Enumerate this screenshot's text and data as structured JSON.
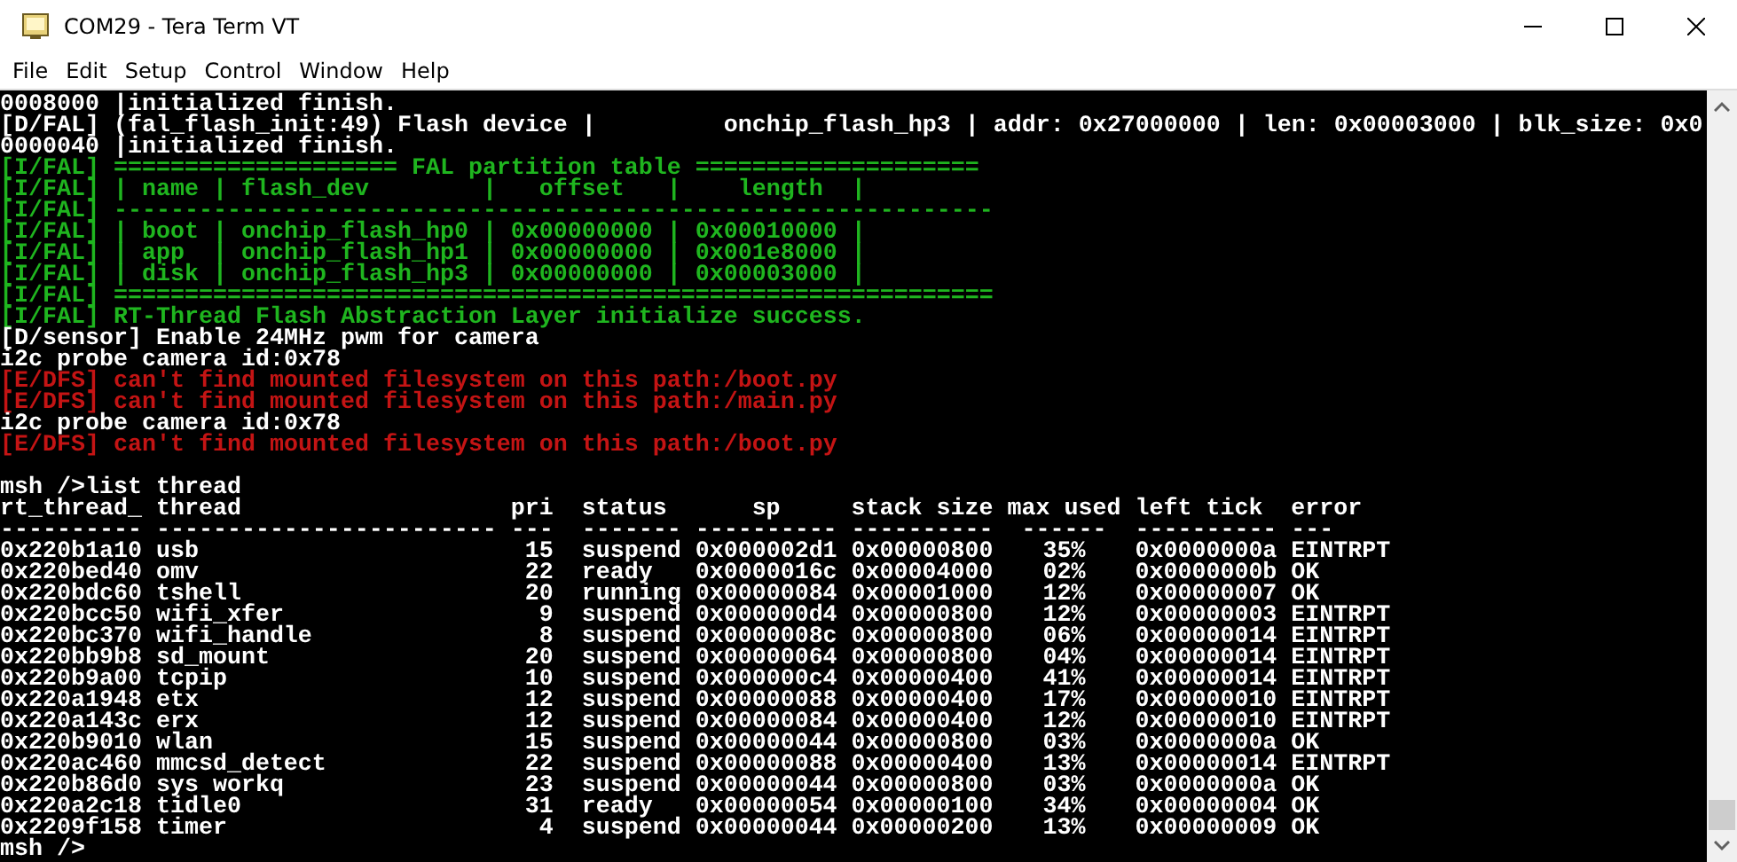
{
  "window": {
    "title": "COM29 - Tera Term VT"
  },
  "menu": [
    "File",
    "Edit",
    "Setup",
    "Control",
    "Window",
    "Help"
  ],
  "terminal": {
    "lines": [
      {
        "kind": "text",
        "color": "#ffffff",
        "text": "0008000 |initialized finish."
      },
      {
        "kind": "text",
        "color": "#ffffff",
        "text": "[D/FAL] (fal_flash_init:49) Flash device |         onchip_flash_hp3 | addr: 0x27000000 | len: 0x00003000 | blk_size: 0x0"
      },
      {
        "kind": "text",
        "color": "#ffffff",
        "text": "0000040 |initialized finish."
      },
      {
        "kind": "text",
        "color": "#1fb51f",
        "text": "[I/FAL] ==================== FAL partition table ===================="
      },
      {
        "kind": "text",
        "color": "#1fb51f",
        "text": "[I/FAL] | name | flash_dev        |   offset   |    length  |"
      },
      {
        "kind": "text",
        "color": "#1fb51f",
        "text": "[I/FAL] --------------------------------------------------------------"
      },
      {
        "kind": "text",
        "color": "#1fb51f",
        "text": "[I/FAL] | boot | onchip_flash_hp0 | 0x00000000 | 0x00010000 |"
      },
      {
        "kind": "text",
        "color": "#1fb51f",
        "text": "[I/FAL] | app  | onchip_flash_hp1 | 0x00000000 | 0x001e8000 |"
      },
      {
        "kind": "text",
        "color": "#1fb51f",
        "text": "[I/FAL] | disk | onchip_flash_hp3 | 0x00000000 | 0x00003000 |"
      },
      {
        "kind": "text",
        "color": "#1fb51f",
        "text": "[I/FAL] =============================================================="
      },
      {
        "kind": "text",
        "color": "#1fb51f",
        "text": "[I/FAL] RT-Thread Flash Abstraction Layer initialize success."
      },
      {
        "kind": "text",
        "color": "#ffffff",
        "text": "[D/sensor] Enable 24MHz pwm for camera"
      },
      {
        "kind": "text",
        "color": "#ffffff",
        "text": "i2c probe camera id:0x78"
      },
      {
        "kind": "text",
        "color": "#c41414",
        "text": "[E/DFS] can't find mounted filesystem on this path:/boot.py"
      },
      {
        "kind": "text",
        "color": "#c41414",
        "text": "[E/DFS] can't find mounted filesystem on this path:/main.py"
      },
      {
        "kind": "text",
        "color": "#ffffff",
        "text": "i2c probe camera id:0x78"
      },
      {
        "kind": "text",
        "color": "#c41414",
        "text": "[E/DFS] can't find mounted filesystem on this path:/boot.py"
      },
      {
        "kind": "blank"
      },
      {
        "kind": "text",
        "color": "#ffffff",
        "text": "msh />list thread"
      }
    ],
    "thread_table": {
      "columns": [
        {
          "label": "rt_thread_",
          "rule": "----------"
        },
        {
          "label": "thread",
          "rule": "------------------------"
        },
        {
          "label": "pri",
          "rule": "---"
        },
        {
          "label": "status",
          "rule": "-------"
        },
        {
          "label": "sp",
          "rule": "----------"
        },
        {
          "label": "stack size",
          "rule": "----------"
        },
        {
          "label": "max used",
          "rule": "------"
        },
        {
          "label": "left tick",
          "rule": "----------"
        },
        {
          "label": "error",
          "rule": "---"
        }
      ],
      "rows": [
        {
          "cells": [
            "0x220b1a10",
            "usb",
            "15",
            "suspend",
            "0x000002d1",
            "0x00000800",
            "35%",
            "0x0000000a",
            "EINTRPT"
          ]
        },
        {
          "cells": [
            "0x220bed40",
            "omv",
            "22",
            "ready",
            "0x0000016c",
            "0x00004000",
            "02%",
            "0x0000000b",
            "OK"
          ]
        },
        {
          "cells": [
            "0x220bdc60",
            "tshell",
            "20",
            "running",
            "0x00000084",
            "0x00001000",
            "12%",
            "0x00000007",
            "OK"
          ]
        },
        {
          "cells": [
            "0x220bcc50",
            "wifi_xfer",
            "9",
            "suspend",
            "0x000000d4",
            "0x00000800",
            "12%",
            "0x00000003",
            "EINTRPT"
          ]
        },
        {
          "cells": [
            "0x220bc370",
            "wifi_handle",
            "8",
            "suspend",
            "0x0000008c",
            "0x00000800",
            "06%",
            "0x00000014",
            "EINTRPT"
          ]
        },
        {
          "cells": [
            "0x220bb9b8",
            "sd_mount",
            "20",
            "suspend",
            "0x00000064",
            "0x00000800",
            "04%",
            "0x00000014",
            "EINTRPT"
          ]
        },
        {
          "cells": [
            "0x220b9a00",
            "tcpip",
            "10",
            "suspend",
            "0x000000c4",
            "0x00000400",
            "41%",
            "0x00000014",
            "EINTRPT"
          ]
        },
        {
          "cells": [
            "0x220a1948",
            "etx",
            "12",
            "suspend",
            "0x00000088",
            "0x00000400",
            "17%",
            "0x00000010",
            "EINTRPT"
          ]
        },
        {
          "cells": [
            "0x220a143c",
            "erx",
            "12",
            "suspend",
            "0x00000084",
            "0x00000400",
            "12%",
            "0x00000010",
            "EINTRPT"
          ]
        },
        {
          "cells": [
            "0x220b9010",
            "wlan",
            "15",
            "suspend",
            "0x00000044",
            "0x00000800",
            "03%",
            "0x0000000a",
            "OK"
          ]
        },
        {
          "cells": [
            "0x220ac460",
            "mmcsd_detect",
            "22",
            "suspend",
            "0x00000088",
            "0x00000400",
            "13%",
            "0x00000014",
            "EINTRPT"
          ]
        },
        {
          "cells": [
            "0x220b86d0",
            "sys workq",
            "23",
            "suspend",
            "0x00000044",
            "0x00000800",
            "03%",
            "0x0000000a",
            "OK"
          ]
        },
        {
          "cells": [
            "0x220a2c18",
            "tidle0",
            "31",
            "ready",
            "0x00000054",
            "0x00000100",
            "34%",
            "0x00000004",
            "OK"
          ]
        },
        {
          "cells": [
            "0x2209f158",
            "timer",
            "4",
            "suspend",
            "0x00000044",
            "0x00000200",
            "13%",
            "0x00000009",
            "OK"
          ]
        }
      ]
    },
    "prompt": "msh />"
  }
}
